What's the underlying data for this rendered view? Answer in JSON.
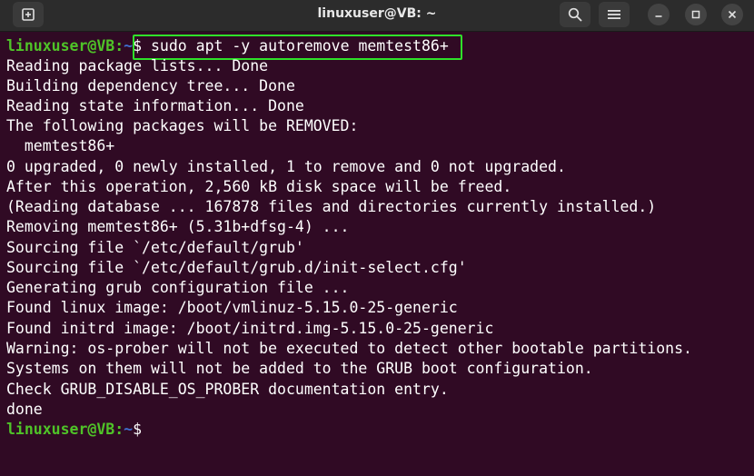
{
  "window": {
    "title": "linuxuser@VB: ~"
  },
  "prompt": {
    "user_host": "linuxuser@VB",
    "colon": ":",
    "path": "~",
    "symbol": "$"
  },
  "command": "$ sudo apt -y autoremove memtest86+",
  "output": [
    "Reading package lists... Done",
    "Building dependency tree... Done",
    "Reading state information... Done",
    "The following packages will be REMOVED:",
    "  memtest86+",
    "0 upgraded, 0 newly installed, 1 to remove and 0 not upgraded.",
    "After this operation, 2,560 kB disk space will be freed.",
    "(Reading database ... 167878 files and directories currently installed.)",
    "Removing memtest86+ (5.31b+dfsg-4) ...",
    "Sourcing file `/etc/default/grub'",
    "Sourcing file `/etc/default/grub.d/init-select.cfg'",
    "Generating grub configuration file ...",
    "Found linux image: /boot/vmlinuz-5.15.0-25-generic",
    "Found initrd image: /boot/initrd.img-5.15.0-25-generic",
    "Warning: os-prober will not be executed to detect other bootable partitions.",
    "Systems on them will not be added to the GRUB boot configuration.",
    "Check GRUB_DISABLE_OS_PROBER documentation entry.",
    "done"
  ],
  "icons": {
    "new_tab": "new-tab-icon",
    "search": "search-icon",
    "menu": "hamburger-menu-icon",
    "minimize": "minimize-icon",
    "maximize": "maximize-icon",
    "close": "close-icon"
  },
  "colors": {
    "terminal_bg": "#300a24",
    "titlebar_bg": "#2c2c2c",
    "prompt_user": "#4fc328",
    "prompt_path": "#3f6fcf",
    "text": "#ffffff",
    "highlight_box": "#2fe02a"
  }
}
